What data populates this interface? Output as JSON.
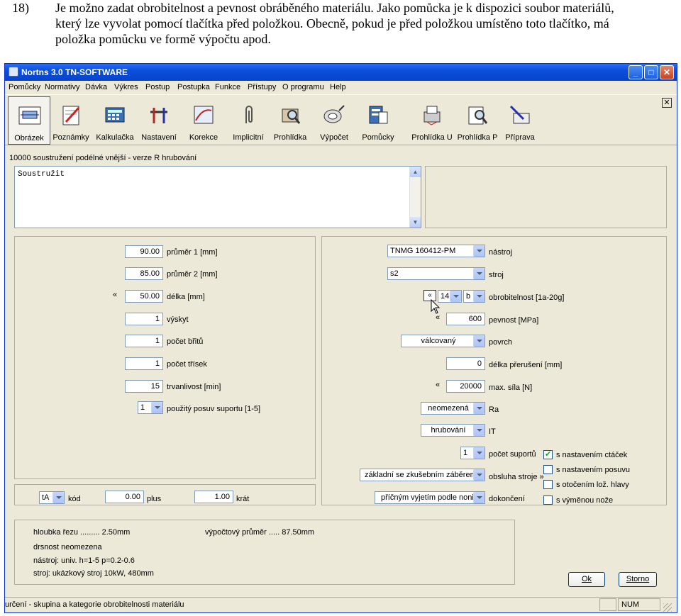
{
  "doc": {
    "number": "18)",
    "lines": [
      "Je možno zadat obrobitelnost a pevnost obráběného materiálu. Jako pomůcka je k dispozici soubor materiálů,",
      "který lze vyvolat pomocí tlačítka před položkou. Obecně, pokud je před položkou umístěno toto tlačítko, má",
      "položka pomůcku ve formě výpočtu apod."
    ]
  },
  "window": {
    "title": "Nortns 3.0 TN-SOFTWARE"
  },
  "menu": [
    "Pomůcky",
    "Normativy",
    "Dávka",
    "Výkres",
    "Postup",
    "Postupka",
    "Funkce",
    "Přístupy",
    "O programu",
    "Help"
  ],
  "toolbar": [
    "Obrázek",
    "Poznámky",
    "Kalkulačka",
    "Nastavení",
    "Korekce",
    "Implicitní",
    "Prohlídka",
    "Výpočet",
    "Pomůcky",
    "Prohlídka U",
    "Prohlídka P",
    "Příprava"
  ],
  "operation_title": "10000 soustružení podélné vnější - verze R hrubování",
  "note_text": "Soustružit",
  "left": {
    "prumer1": {
      "value": "90.00",
      "label": "průměr 1 [mm]"
    },
    "prumer2": {
      "value": "85.00",
      "label": "průměr 2 [mm]"
    },
    "delka": {
      "value": "50.00",
      "label": "délka [mm]",
      "btn": "«"
    },
    "vyskyt": {
      "value": "1",
      "label": "výskyt"
    },
    "britu": {
      "value": "1",
      "label": "počet břitů"
    },
    "trisek": {
      "value": "1",
      "label": "počet třísek"
    },
    "trvanlivost": {
      "value": "15",
      "label": "trvanlivost [min]"
    },
    "posuv": {
      "value": "1",
      "label": "použitý posuv suportu [1-5]"
    }
  },
  "right": {
    "nastroj": {
      "value": "TNMG 160412-PM",
      "label": "nástroj"
    },
    "stroj": {
      "value": "s2",
      "label": "stroj"
    },
    "obrobitelnost": {
      "btn": "«",
      "num": "14",
      "letter": "b",
      "label": "obrobitelnost [1a-20g]"
    },
    "pevnost": {
      "btn": "«",
      "value": "600",
      "label": "pevnost [MPa]"
    },
    "povrch": {
      "value": "válcovaný",
      "label": "povrch"
    },
    "preruseni": {
      "value": "0",
      "label": "délka přerušení [mm]"
    },
    "sila": {
      "btn": "«",
      "value": "20000",
      "label": "max. síla [N]"
    },
    "ra": {
      "value": "neomezená",
      "label": "Ra"
    },
    "it": {
      "value": "hrubování",
      "label": "IT"
    },
    "suportu": {
      "value": "1",
      "label": "počet suportů"
    },
    "obsluha": {
      "value": "základní se zkušebním záběrem",
      "label": "obsluha stroje »"
    },
    "dokonceni": {
      "value": "příčným vyjetím podle nonia",
      "label": "dokončení"
    }
  },
  "checks": [
    {
      "label": "s nastavením ctáček",
      "checked": true
    },
    {
      "label": "s nastavením posuvu",
      "checked": false
    },
    {
      "label": "s otočením lož. hlavy",
      "checked": false
    },
    {
      "label": "s výměnou nože",
      "checked": false
    }
  ],
  "bottom_row": {
    "kod_value": "tA",
    "kod_label": "kód",
    "plus_value": "0.00",
    "plus_label": "plus",
    "krat_value": "1.00",
    "krat_label": "krát"
  },
  "info": {
    "hloubka": "hloubka řezu ......... 2.50mm",
    "vyp_prumer": "výpočtový průměr .....    87.50mm",
    "drsnost": "drsnost neomezena",
    "nastroj": "nástroj: univ. h=1-5 p=0.2-0.6",
    "stroj": "stroj: ukázkový stroj 10kW, 480mm"
  },
  "buttons": {
    "ok": "Ok",
    "storno": "Storno"
  },
  "status": {
    "text": "určení - skupina a kategorie obrobitelnosti materiálu",
    "num": "NUM"
  }
}
